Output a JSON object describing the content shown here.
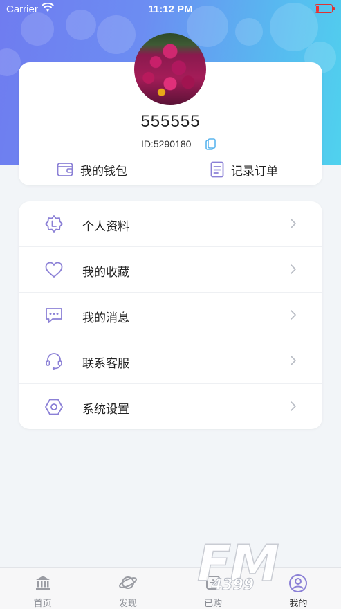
{
  "status_bar": {
    "carrier": "Carrier",
    "time": "11:12 PM"
  },
  "profile": {
    "username": "555555",
    "user_id": "ID:5290180",
    "wallet_label": "我的钱包",
    "orders_label": "记录订单"
  },
  "menu": {
    "items": [
      {
        "label": "个人资料",
        "icon": "profile-badge-icon"
      },
      {
        "label": "我的收藏",
        "icon": "heart-icon"
      },
      {
        "label": "我的消息",
        "icon": "message-icon"
      },
      {
        "label": "联系客服",
        "icon": "headset-icon"
      },
      {
        "label": "系统设置",
        "icon": "settings-hex-icon"
      }
    ]
  },
  "tabbar": {
    "tabs": [
      {
        "label": "首页",
        "icon": "bank-icon"
      },
      {
        "label": "发现",
        "icon": "planet-icon"
      },
      {
        "label": "已购",
        "icon": "purchased-icon"
      },
      {
        "label": "我的",
        "icon": "user-icon",
        "active": true
      }
    ]
  },
  "watermark": {
    "main": "FM",
    "sub": "4399"
  },
  "colors": {
    "accent": "#8b80d6",
    "header_gradient_start": "#6f7cf0",
    "header_gradient_end": "#4fd2ee",
    "background": "#f2f5f8"
  }
}
